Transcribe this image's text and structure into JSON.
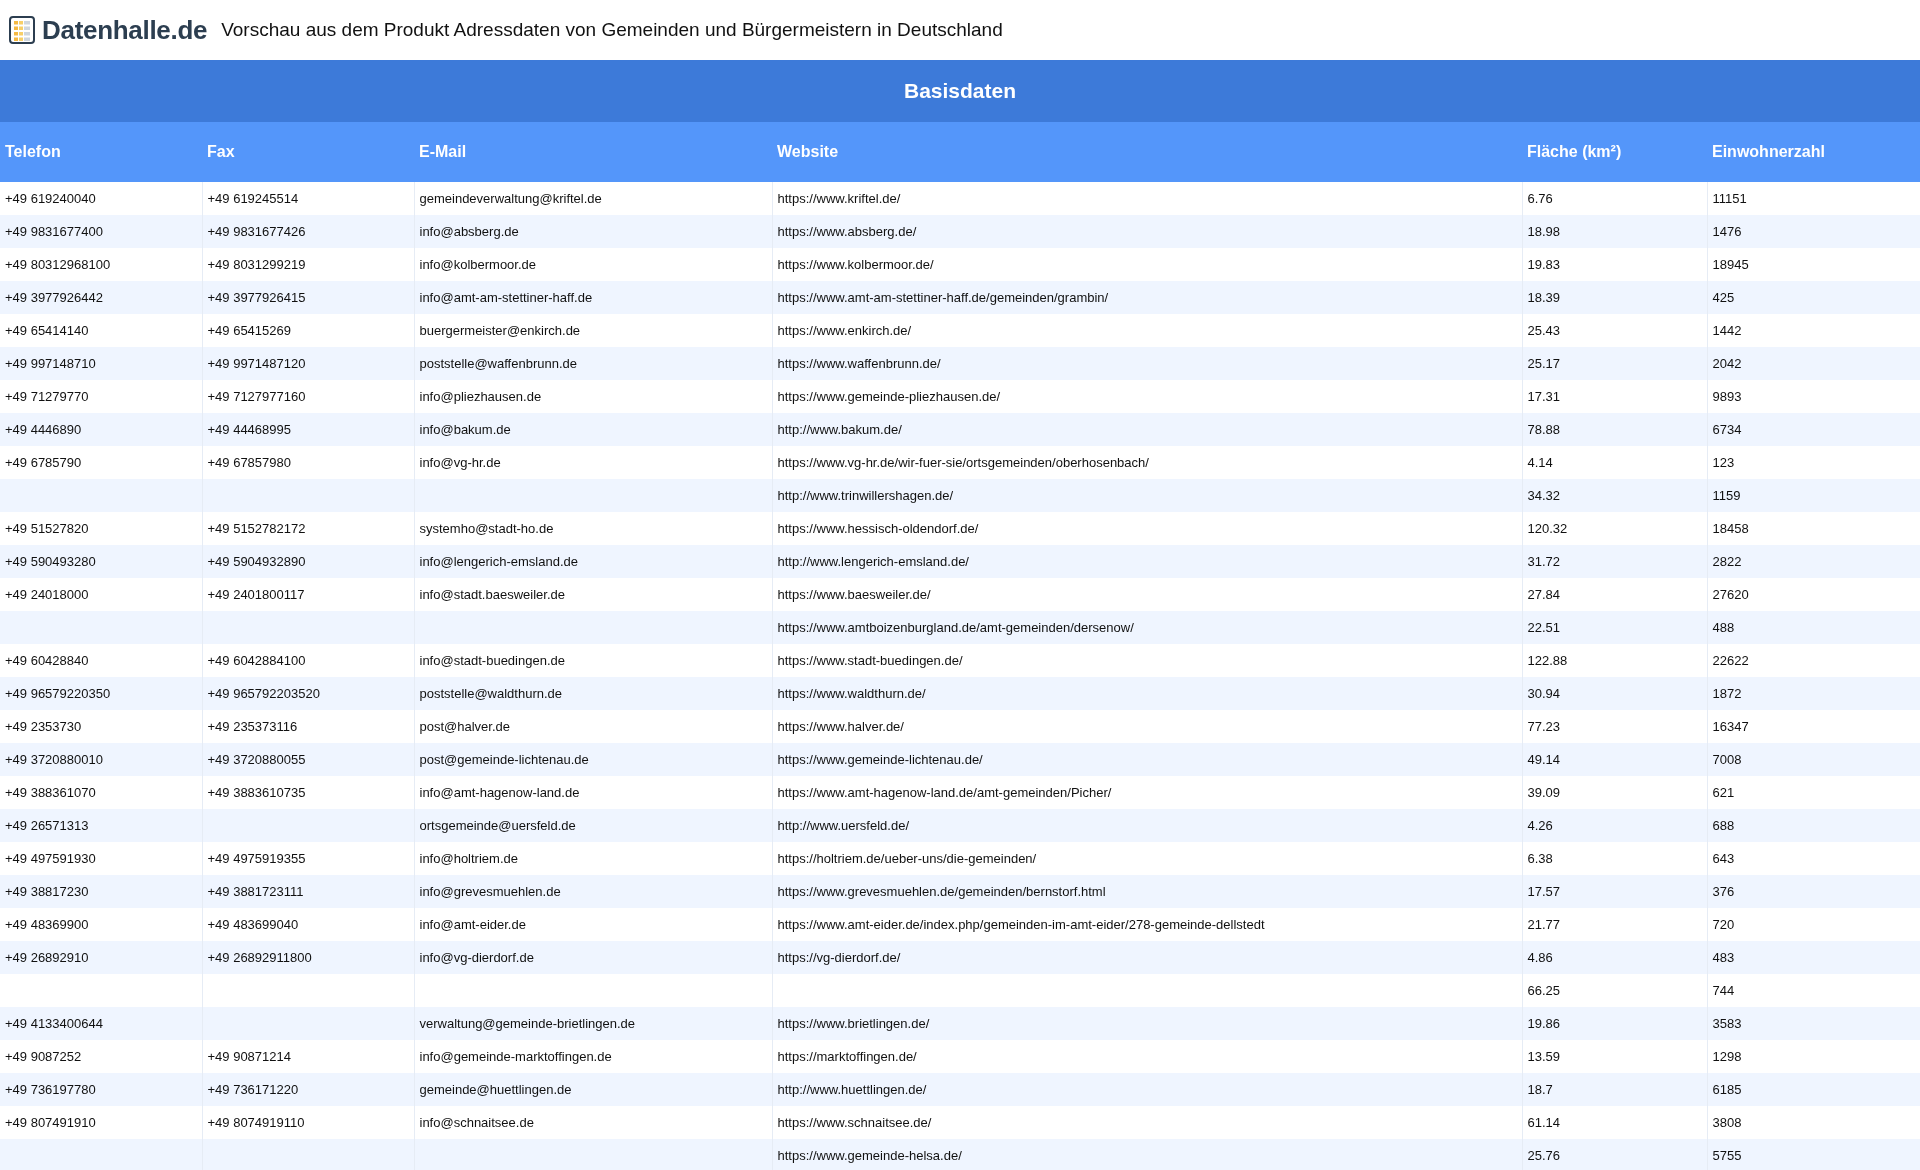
{
  "header": {
    "logo": "Datenhalle.de",
    "title": "Vorschau aus dem Produkt Adressdaten von Gemeinden und Bürgermeistern in Deutschland"
  },
  "table": {
    "group_title": "Basisdaten",
    "columns": [
      "Telefon",
      "Fax",
      "E-Mail",
      "Website",
      "Fläche (km²)",
      "Einwohnerzahl"
    ],
    "rows": [
      [
        "+49 619240040",
        "+49 619245514",
        "gemeindeverwaltung@kriftel.de",
        "https://www.kriftel.de/",
        "6.76",
        "11151"
      ],
      [
        "+49 9831677400",
        "+49 9831677426",
        "info@absberg.de",
        "https://www.absberg.de/",
        "18.98",
        "1476"
      ],
      [
        "+49 80312968100",
        "+49 8031299219",
        "info@kolbermoor.de",
        "https://www.kolbermoor.de/",
        "19.83",
        "18945"
      ],
      [
        "+49 3977926442",
        "+49 3977926415",
        "info@amt-am-stettiner-haff.de",
        "https://www.amt-am-stettiner-haff.de/gemeinden/grambin/",
        "18.39",
        "425"
      ],
      [
        "+49 65414140",
        "+49 65415269",
        "buergermeister@enkirch.de",
        "https://www.enkirch.de/",
        "25.43",
        "1442"
      ],
      [
        "+49 997148710",
        "+49 9971487120",
        "poststelle@waffenbrunn.de",
        "https://www.waffenbrunn.de/",
        "25.17",
        "2042"
      ],
      [
        "+49 71279770",
        "+49 7127977160",
        "info@pliezhausen.de",
        "https://www.gemeinde-pliezhausen.de/",
        "17.31",
        "9893"
      ],
      [
        "+49 4446890",
        "+49 44468995",
        "info@bakum.de",
        "http://www.bakum.de/",
        "78.88",
        "6734"
      ],
      [
        "+49 6785790",
        "+49 67857980",
        "info@vg-hr.de",
        "https://www.vg-hr.de/wir-fuer-sie/ortsgemeinden/oberhosenbach/",
        "4.14",
        "123"
      ],
      [
        null,
        null,
        null,
        "http://www.trinwillershagen.de/",
        "34.32",
        "1159"
      ],
      [
        "+49 51527820",
        "+49 5152782172",
        "systemho@stadt-ho.de",
        "https://www.hessisch-oldendorf.de/",
        "120.32",
        "18458"
      ],
      [
        "+49 590493280",
        "+49 5904932890",
        "info@lengerich-emsland.de",
        "http://www.lengerich-emsland.de/",
        "31.72",
        "2822"
      ],
      [
        "+49 24018000",
        "+49 2401800117",
        "info@stadt.baesweiler.de",
        "https://www.baesweiler.de/",
        "27.84",
        "27620"
      ],
      [
        null,
        null,
        null,
        "https://www.amtboizenburgland.de/amt-gemeinden/dersenow/",
        "22.51",
        "488"
      ],
      [
        "+49 60428840",
        "+49 6042884100",
        "info@stadt-buedingen.de",
        "https://www.stadt-buedingen.de/",
        "122.88",
        "22622"
      ],
      [
        "+49 96579220350",
        "+49 965792203520",
        "poststelle@waldthurn.de",
        "https://www.waldthurn.de/",
        "30.94",
        "1872"
      ],
      [
        "+49 2353730",
        "+49 235373116",
        "post@halver.de",
        "https://www.halver.de/",
        "77.23",
        "16347"
      ],
      [
        "+49 3720880010",
        "+49 3720880055",
        "post@gemeinde-lichtenau.de",
        "https://www.gemeinde-lichtenau.de/",
        "49.14",
        "7008"
      ],
      [
        "+49 388361070",
        "+49 3883610735",
        "info@amt-hagenow-land.de",
        "https://www.amt-hagenow-land.de/amt-gemeinden/Picher/",
        "39.09",
        "621"
      ],
      [
        "+49 26571313",
        null,
        "ortsgemeinde@uersfeld.de",
        "http://www.uersfeld.de/",
        "4.26",
        "688"
      ],
      [
        "+49 497591930",
        "+49 4975919355",
        "info@holtriem.de",
        "https://holtriem.de/ueber-uns/die-gemeinden/",
        "6.38",
        "643"
      ],
      [
        "+49 38817230",
        "+49 3881723111",
        "info@grevesmuehlen.de",
        "https://www.grevesmuehlen.de/gemeinden/bernstorf.html",
        "17.57",
        "376"
      ],
      [
        "+49 48369900",
        "+49 483699040",
        "info@amt-eider.de",
        "https://www.amt-eider.de/index.php/gemeinden-im-amt-eider/278-gemeinde-dellstedt",
        "21.77",
        "720"
      ],
      [
        "+49 26892910",
        "+49 26892911800",
        "info@vg-dierdorf.de",
        "https://vg-dierdorf.de/",
        "4.86",
        "483"
      ],
      [
        null,
        null,
        null,
        null,
        "66.25",
        "744"
      ],
      [
        "+49 4133400644",
        null,
        "verwaltung@gemeinde-brietlingen.de",
        "https://www.brietlingen.de/",
        "19.86",
        "3583"
      ],
      [
        "+49 9087252",
        "+49 90871214",
        "info@gemeinde-marktoffingen.de",
        "https://marktoffingen.de/",
        "13.59",
        "1298"
      ],
      [
        "+49 736197780",
        "+49 736171220",
        "gemeinde@huettlingen.de",
        "http://www.huettlingen.de/",
        "18.7",
        "6185"
      ],
      [
        "+49 807491910",
        "+49 8074919110",
        "info@schnaitsee.de",
        "https://www.schnaitsee.de/",
        "61.14",
        "3808"
      ],
      [
        null,
        null,
        null,
        "https://www.gemeinde-helsa.de/",
        "25.76",
        "5755"
      ]
    ]
  }
}
